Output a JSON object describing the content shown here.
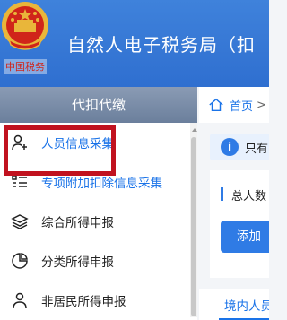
{
  "header": {
    "title": "自然人电子税务局（扣",
    "sub_logo_text": "中国税务",
    "colors": {
      "bar": "#3a7cd8",
      "emblem_red": "#d0251a",
      "emblem_gold": "#e9b63a"
    }
  },
  "sidebar": {
    "title": "代扣代缴",
    "items": [
      {
        "label": "人员信息采集",
        "icon": "person-add-icon",
        "active": true
      },
      {
        "label": "专项附加扣除信息采集",
        "icon": "list-icon",
        "active": false
      },
      {
        "label": "综合所得申报",
        "icon": "layers-icon",
        "active": false
      },
      {
        "label": "分类所得申报",
        "icon": "pie-chart-icon",
        "active": false
      },
      {
        "label": "非居民所得申报",
        "icon": "person-icon",
        "active": false
      }
    ]
  },
  "main": {
    "breadcrumb": {
      "home": "首页",
      "separator": ">"
    },
    "notice": {
      "text": "只有"
    },
    "summary": {
      "label": "总人数"
    },
    "add_button": "添加",
    "tab": "境内人员"
  }
}
